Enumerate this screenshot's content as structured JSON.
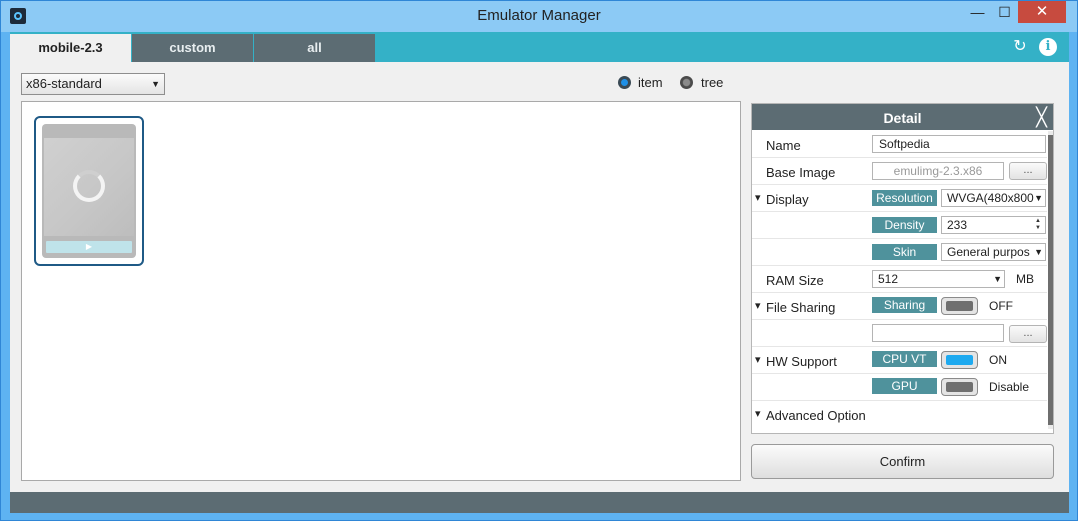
{
  "window": {
    "title": "Emulator Manager",
    "minimize": "—",
    "maximize": "☐",
    "close": "✕"
  },
  "tabs": [
    {
      "label": "mobile-2.3",
      "active": true
    },
    {
      "label": "custom",
      "active": false
    },
    {
      "label": "all",
      "active": false
    }
  ],
  "toolbar": {
    "refresh_icon": "refresh-icon",
    "info_icon": "info-icon",
    "refresh_glyph": "↻",
    "info_glyph": "i"
  },
  "filter": {
    "selected": "x86-standard"
  },
  "view_mode": {
    "item_label": "item",
    "tree_label": "tree",
    "selected": "item"
  },
  "detail": {
    "title": "Detail",
    "close_glyph": "╳",
    "name_label": "Name",
    "name_value": "Softpedia",
    "base_image_label": "Base Image",
    "base_image_value": "emulimg-2.3.x86",
    "browse_label": "...",
    "display_label": "Display",
    "resolution_label": "Resolution",
    "resolution_value": "WVGA(480x800",
    "density_label": "Density",
    "density_value": "233",
    "skin_label": "Skin",
    "skin_value": "General purpos",
    "ram_label": "RAM Size",
    "ram_value": "512",
    "ram_unit": "MB",
    "file_sharing_label": "File Sharing",
    "sharing_label": "Sharing",
    "sharing_state": "OFF",
    "sharing_path": "",
    "hw_support_label": "HW Support",
    "cpu_vt_label": "CPU VT",
    "cpu_vt_state": "ON",
    "gpu_label": "GPU",
    "gpu_state": "Disable",
    "advanced_label": "Advanced Option"
  },
  "confirm_label": "Confirm",
  "colors": {
    "accent": "#34b1c7",
    "header": "#5c6c73",
    "pill": "#4f929c",
    "toggle_on": "#1eaaf0"
  }
}
